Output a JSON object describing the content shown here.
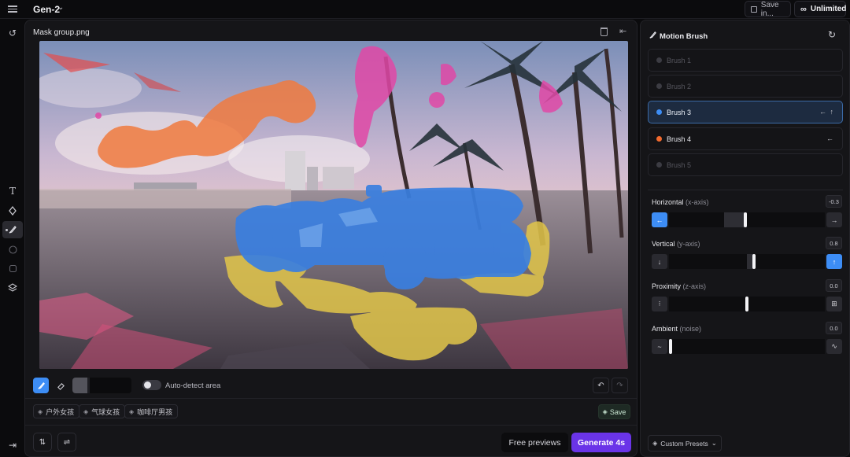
{
  "topbar": {
    "model": "Gen-2",
    "save_label": "Save in...",
    "unlimited_label": "Unlimited",
    "menu_icon": "menu-icon",
    "infinity_icon": "∞"
  },
  "rail": {
    "undo_icon": "↺",
    "text_icon": "T",
    "direction_icon": "⇄",
    "brush_icon": "🖌",
    "bottom_icon": "⇥"
  },
  "editor": {
    "file_name": "Mask group.png",
    "auto_detect_label": "Auto-detect area",
    "brush_size": 0.25,
    "auto_detect_on": false,
    "presets": [
      {
        "label": "户外女孩"
      },
      {
        "label": "气球女孩"
      },
      {
        "label": "咖啡厅男孩"
      }
    ],
    "save_label": "Save",
    "free_previews_label": "Free previews",
    "generate_label": "Generate 4s"
  },
  "motion_brush": {
    "title": "Motion Brush",
    "brushes": [
      {
        "label": "Brush 1",
        "state": "disabled",
        "arrows": ""
      },
      {
        "label": "Brush 2",
        "state": "disabled",
        "arrows": ""
      },
      {
        "label": "Brush 3",
        "state": "active",
        "arrows": "← ↑",
        "color": "#3d8df5"
      },
      {
        "label": "Brush 4",
        "state": "normal",
        "arrows": "←",
        "color": "#f26a2e"
      },
      {
        "label": "Brush 5",
        "state": "disabled",
        "arrows": ""
      }
    ],
    "controls": [
      {
        "label": "Horizontal",
        "axis": "(x-axis)",
        "value": "-0.3",
        "left_icon": "←",
        "right_icon": "→"
      },
      {
        "label": "Vertical",
        "axis": "(y-axis)",
        "value": "0.8",
        "left_icon": "↓",
        "right_icon": "↑"
      },
      {
        "label": "Proximity",
        "axis": "(z-axis)",
        "value": "0.0",
        "left_icon": "⁝",
        "right_icon": "⊞"
      },
      {
        "label": "Ambient",
        "axis": "(noise)",
        "value": "0.0",
        "left_icon": "~",
        "right_icon": "∿"
      }
    ],
    "custom_presets_label": "Custom Presets"
  }
}
